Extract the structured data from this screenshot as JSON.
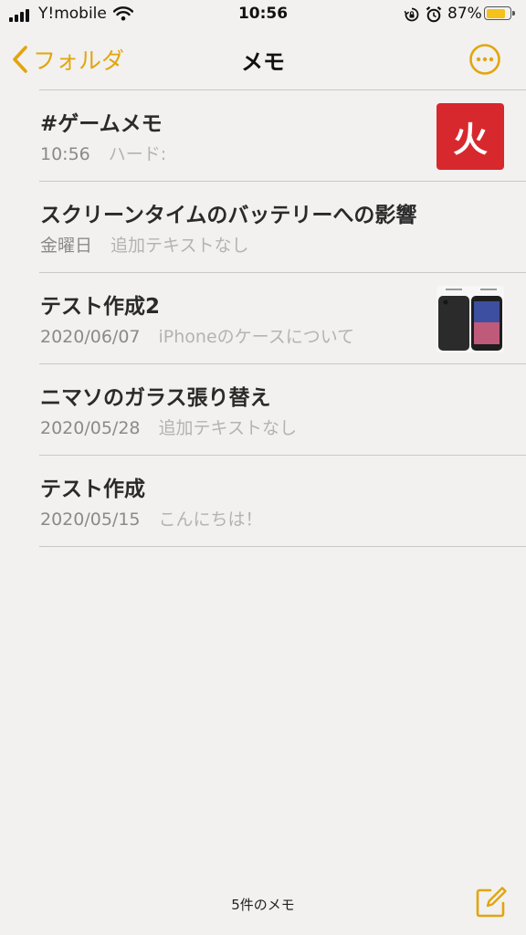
{
  "status_bar": {
    "carrier": "Y!mobile",
    "time": "10:56",
    "battery_percent": "87%",
    "battery_level": 0.87,
    "icons": [
      "signal-icon",
      "wifi-icon",
      "rotation-lock-icon",
      "alarm-icon",
      "battery-icon"
    ]
  },
  "nav": {
    "back_label": "フォルダ",
    "title": "メモ",
    "more_icon": "ellipsis-circle-icon"
  },
  "notes": [
    {
      "title": "#ゲームメモ",
      "date": "10:56",
      "preview": "ハード:",
      "thumbnail": "火"
    },
    {
      "title": "スクリーンタイムのバッテリーへの影響",
      "date": "金曜日",
      "preview": "追加テキストなし"
    },
    {
      "title": "テスト作成2",
      "date": "2020/06/07",
      "preview": "iPhoneのケースについて",
      "thumbnail": "iphone-case-image"
    },
    {
      "title": "ニマソのガラス張り替え",
      "date": "2020/05/28",
      "preview": "追加テキストなし"
    },
    {
      "title": "テスト作成",
      "date": "2020/05/15",
      "preview": "こんにちは！"
    }
  ],
  "footer": {
    "count_label": "5件のメモ",
    "compose_icon": "compose-icon"
  },
  "colors": {
    "accent": "#e2a50e",
    "background": "#f2f1ef",
    "thumbnail_red": "#d7282e"
  }
}
